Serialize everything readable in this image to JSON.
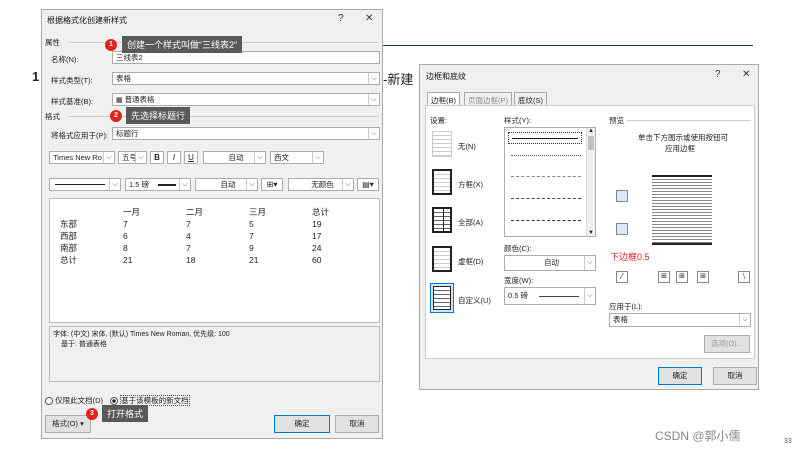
{
  "slide": {
    "number_prefix": "1",
    "new_label": "-新建",
    "watermark": "CSDN @郭小儒",
    "page_number": "33"
  },
  "left": {
    "title": "根据格式化创建新样式",
    "help": "?",
    "close": "✕",
    "properties_header": "属性",
    "name_label": "名称(N):",
    "name_value": "三线表2",
    "type_label": "样式类型(T):",
    "type_value": "表格",
    "base_label": "样式基准(B):",
    "base_value": "普通表格",
    "format_header": "格式",
    "apply_label": "将格式应用于(P):",
    "apply_value": "标题行",
    "font_value": "Times New Ro",
    "size_value": "五号",
    "bold": "B",
    "italic": "I",
    "underline": "U",
    "color_value": "自动",
    "script_value": "西文",
    "border_width": "1.5 磅",
    "border_color": "自动",
    "shading": "无颜色",
    "preview": {
      "header": [
        "",
        "一月",
        "二月",
        "三月",
        "总计"
      ],
      "rows": [
        [
          "东部",
          "7",
          "7",
          "5",
          "19"
        ],
        [
          "西部",
          "6",
          "4",
          "7",
          "17"
        ],
        [
          "南部",
          "8",
          "7",
          "9",
          "24"
        ],
        [
          "总计",
          "21",
          "18",
          "21",
          "60"
        ]
      ]
    },
    "desc_line1": "字体: (中文) 宋体, (默认) Times New Roman, 优先级: 100",
    "desc_line2": "基于: 普通表格",
    "radio_doc_only": "仅限此文档(D)",
    "radio_template": "基于该模板的新文档",
    "format_button": "格式(O) ▾",
    "ok": "确定",
    "cancel": "取消"
  },
  "callouts": {
    "c1_num": "1",
    "c1_text": "创建一个样式叫做“三线表2”",
    "c2_num": "2",
    "c2_text": "先选择标题行",
    "c3_num": "3",
    "c3_text": "打开格式"
  },
  "right": {
    "title": "边框和底纹",
    "help": "?",
    "close": "✕",
    "tabs": [
      "边框(B)",
      "页面边框(P)",
      "底纹(S)"
    ],
    "settings_label": "设置:",
    "settings": [
      "无(N)",
      "方框(X)",
      "全部(A)",
      "虚框(D)",
      "自定义(U)"
    ],
    "style_label": "样式(Y):",
    "color_label": "颜色(C):",
    "color_value": "自动",
    "width_label": "宽度(W):",
    "width_value": "0.5 磅",
    "preview_label": "预览",
    "preview_hint_1": "单击下方图示或使用按钮可",
    "preview_hint_2": "应用边框",
    "bottom_border_note": "下边框0.5",
    "apply_label": "应用于(L):",
    "apply_value": "表格",
    "options_button": "选项(O)...",
    "ok": "确定",
    "cancel": "取消"
  }
}
